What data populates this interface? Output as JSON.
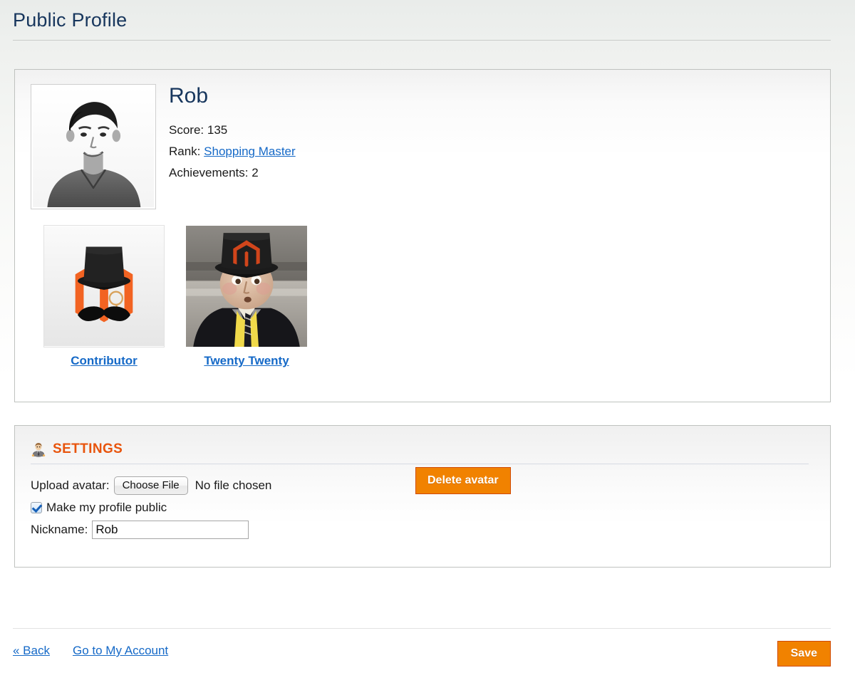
{
  "header": {
    "title": "Public Profile"
  },
  "profile": {
    "avatar_alt": "user-avatar-photo",
    "name": "Rob",
    "score_label": "Score:",
    "score_value": "135",
    "rank_label": "Rank:",
    "rank_value": "Shopping Master",
    "achievements_label": "Achievements:",
    "achievements_value": "2",
    "badges": [
      {
        "label": "Contributor",
        "icon": "magento-tophat-mustache-badge"
      },
      {
        "label": "Twenty Twenty",
        "icon": "tophat-character-badge"
      }
    ]
  },
  "settings": {
    "icon": "businessman-icon",
    "title": "SETTINGS",
    "upload_avatar_label": "Upload avatar:",
    "choose_file_label": "Choose File",
    "no_file_text": "No file chosen",
    "delete_avatar_label": "Delete avatar",
    "public_checkbox_label": "Make my profile public",
    "public_checkbox_checked": "true",
    "nickname_label": "Nickname:",
    "nickname_value": "Rob",
    "nickname_placeholder": ""
  },
  "footer": {
    "back_label": "« Back",
    "account_label": "Go to My Account",
    "save_label": "Save"
  },
  "colors": {
    "title": "#17365d",
    "link": "#1569c7",
    "accent_orange": "#f18200",
    "settings_heading": "#e8540c",
    "panel_border": "#bfc2bf"
  }
}
